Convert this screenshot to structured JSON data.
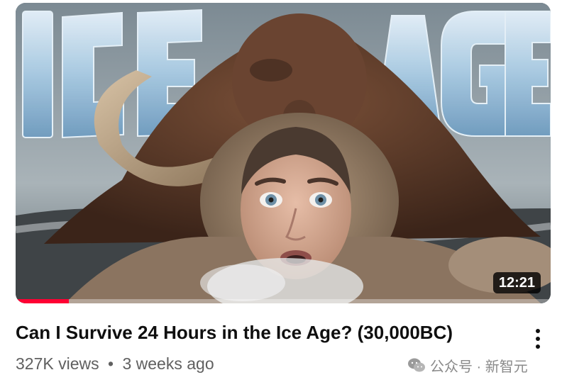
{
  "video": {
    "thumbnail_text": "ICE AGE",
    "duration": "12:21",
    "watch_progress": 0.1,
    "title": "Can I Survive 24 Hours in the Ice Age? (30,000BC)",
    "views": "327K views",
    "separator": "•",
    "age": "3 weeks ago",
    "menu_icon": "more-vert-icon"
  },
  "watermark": {
    "text": "公众号 · 新智元"
  },
  "colors": {
    "progress": "#ff0033",
    "title": "#0f0f0f",
    "meta": "#606060"
  }
}
